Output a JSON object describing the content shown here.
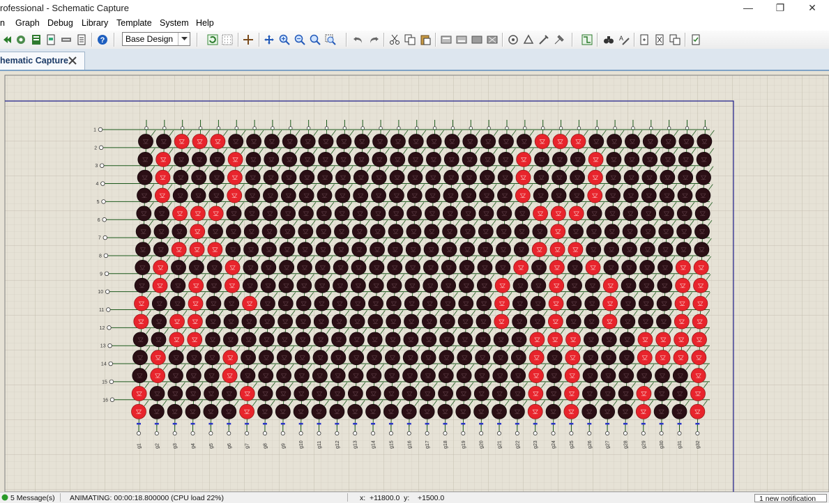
{
  "window": {
    "title": "rofessional - Schematic Capture",
    "controls": [
      {
        "icon": "minimize-icon",
        "label": "—"
      },
      {
        "icon": "restore-icon",
        "label": "❐"
      },
      {
        "icon": "close-icon",
        "label": "✕"
      }
    ]
  },
  "menu": {
    "items": [
      {
        "label": "n"
      },
      {
        "label": "Graph"
      },
      {
        "label": "Debug"
      },
      {
        "label": "Library"
      },
      {
        "label": "Template"
      },
      {
        "label": "System"
      },
      {
        "label": "Help"
      }
    ]
  },
  "toolbar": {
    "design_select": {
      "value": "Base Design"
    },
    "icons": [
      "play-back-icon",
      "component-mode-icon",
      "netlist-icon",
      "export-icon",
      "tape-icon",
      "document-icon",
      "help-icon",
      "refresh-icon",
      "grid-icon",
      "origin-icon",
      "pan-icon",
      "zoom-in-icon",
      "zoom-out-icon",
      "zoom-all-icon",
      "zoom-area-icon",
      "undo-icon",
      "redo-icon",
      "cut-icon",
      "copy-icon",
      "paste-icon",
      "block-copy-icon",
      "block-move-icon",
      "block-rotate-icon",
      "block-delete-icon",
      "pick-device-icon",
      "make-device-icon",
      "packaging-icon",
      "decompose-icon",
      "wire-autorouter-icon",
      "search-icon",
      "property-tool-icon",
      "new-sheet-icon",
      "remove-sheet-icon",
      "sheet-navigate-icon",
      "bill-of-materials-icon"
    ]
  },
  "tab": {
    "label": "hematic Capture",
    "close_icon": "close-icon"
  },
  "schematic": {
    "row_labels": [
      "1",
      "2",
      "3",
      "4",
      "5",
      "6",
      "7",
      "8",
      "9",
      "10",
      "11",
      "12",
      "13",
      "14",
      "15",
      "16"
    ],
    "col_labels": [
      "g1",
      "g2",
      "g3",
      "g4",
      "g5",
      "g6",
      "g7",
      "g8",
      "g9",
      "g10",
      "g11",
      "g12",
      "g13",
      "g14",
      "g15",
      "g16",
      "g17",
      "g18",
      "g19",
      "g20",
      "g21",
      "g22",
      "g23",
      "g24",
      "g25",
      "g26",
      "g27",
      "g28",
      "g29",
      "g30",
      "g31",
      "g32"
    ],
    "led_on_color": "#e8242c",
    "led_off_color": "#2b0f15",
    "lit": [
      [
        3,
        4,
        5,
        23,
        24,
        25
      ],
      [
        2,
        6,
        22,
        26
      ],
      [
        2,
        6,
        22,
        26
      ],
      [
        2,
        6,
        22,
        26
      ],
      [
        3,
        4,
        5,
        23,
        24,
        25
      ],
      [
        4,
        24
      ],
      [
        3,
        4,
        5,
        23,
        24,
        25
      ],
      [
        2,
        6,
        22,
        24,
        26,
        31,
        32
      ],
      [
        2,
        4,
        6,
        21,
        24,
        27,
        31,
        32
      ],
      [
        1,
        4,
        7,
        21,
        24,
        27,
        31,
        32
      ],
      [
        1,
        3,
        4,
        21,
        24,
        27,
        31,
        32
      ],
      [
        3,
        4,
        23,
        24,
        25,
        29,
        30,
        31,
        32
      ],
      [
        2,
        6,
        23,
        25,
        29,
        30,
        31,
        32
      ],
      [
        2,
        6,
        23,
        25,
        32
      ],
      [
        1,
        7,
        23,
        25,
        29,
        32
      ],
      [
        1,
        7,
        23,
        25,
        29,
        32
      ]
    ]
  },
  "status": {
    "messages": "5 Message(s)",
    "animating": "ANIMATING: 00:00:18.800000 (CPU load 22%)",
    "coords": "x:  +11800.0  y:    +1500.0",
    "notification": "1 new notification"
  }
}
